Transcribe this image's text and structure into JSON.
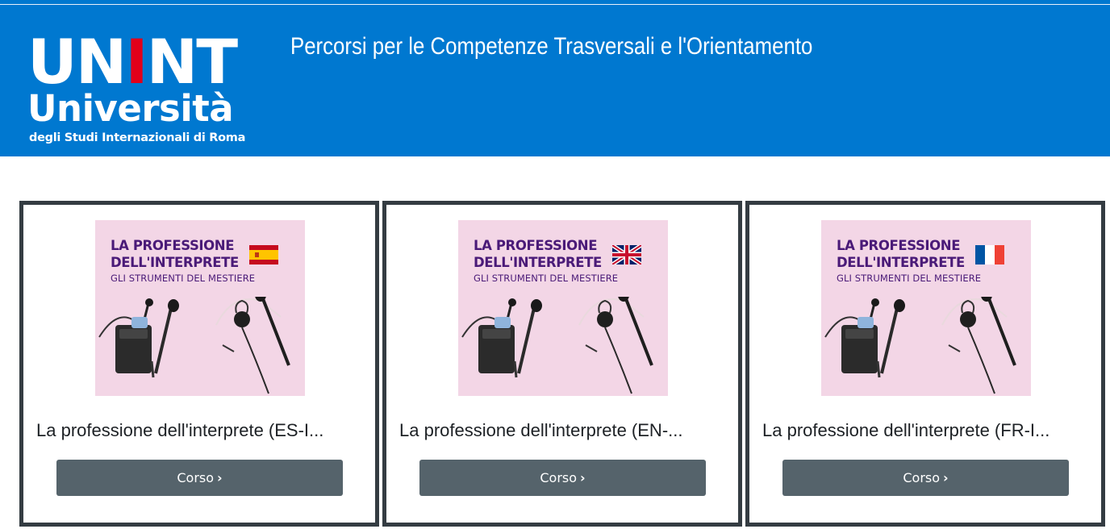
{
  "header": {
    "logo": {
      "line1_part1": "UN",
      "line1_red": "I",
      "line1_part2": "NT",
      "line2": "Università",
      "line3": "degli Studi Internazionali di Roma"
    },
    "title": "Percorsi per le Competenze Trasversali e l'Orientamento"
  },
  "colors": {
    "header_bg": "#0078d0",
    "logo_red": "#e2001a",
    "card_border": "#343c42",
    "button_bg": "#55636b",
    "image_bg": "#f3d6e6",
    "image_text": "#4a1a78"
  },
  "cards": [
    {
      "image": {
        "line1": "LA PROFESSIONE",
        "line2": "DELL'INTERPRETE",
        "line3": "GLI STRUMENTI DEL MESTIERE",
        "flag": "spain-flag-icon"
      },
      "title": "La professione dell'interprete (ES-I...",
      "button_label": "Corso",
      "button_icon": "chevron-right-icon"
    },
    {
      "image": {
        "line1": "LA PROFESSIONE",
        "line2": "DELL'INTERPRETE",
        "line3": "GLI STRUMENTI DEL MESTIERE",
        "flag": "uk-flag-icon"
      },
      "title": "La professione dell'interprete (EN-...",
      "button_label": "Corso",
      "button_icon": "chevron-right-icon"
    },
    {
      "image": {
        "line1": "LA PROFESSIONE",
        "line2": "DELL'INTERPRETE",
        "line3": "GLI STRUMENTI DEL MESTIERE",
        "flag": "france-flag-icon"
      },
      "title": "La professione dell'interprete (FR-I...",
      "button_label": "Corso",
      "button_icon": "chevron-right-icon"
    }
  ]
}
